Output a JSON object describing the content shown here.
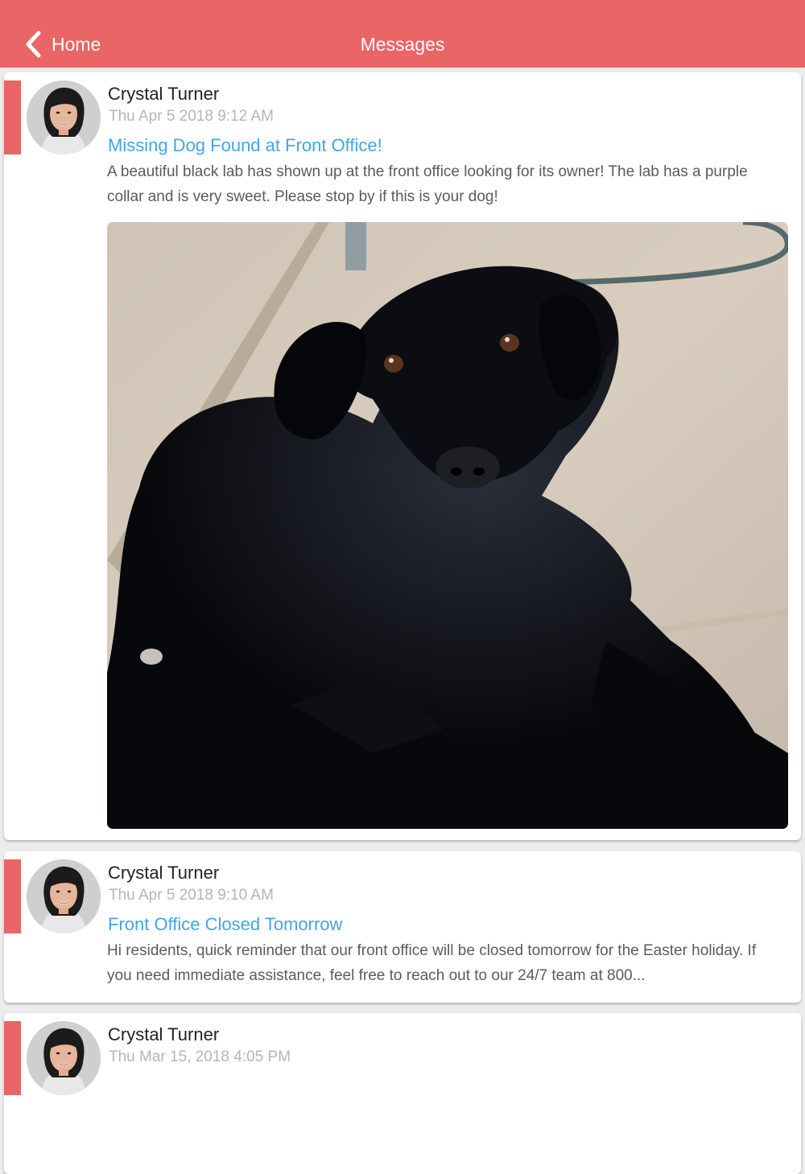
{
  "header": {
    "back_label": "Home",
    "title": "Messages"
  },
  "colors": {
    "accent": "#ea6565",
    "link": "#42a5e6"
  },
  "messages": [
    {
      "author": "Crystal Turner",
      "date": "Thu Apr 5 2018  9:12 AM",
      "subject": "Missing Dog Found at Front Office!",
      "body": "A beautiful black lab has shown up at the front office looking for its owner! The lab has a purple collar and is very sweet. Please stop by if this is your dog!"
    },
    {
      "author": "Crystal Turner",
      "date": "Thu Apr 5 2018  9:10 AM",
      "subject": "Front Office Closed Tomorrow",
      "body": "Hi residents, quick reminder that our front office will be closed tomorrow for the Easter holiday. If you need immediate assistance, feel free to reach out to our 24/7 team at 800..."
    },
    {
      "author": "Crystal Turner",
      "date": "Thu Mar 15, 2018  4:05 PM"
    }
  ]
}
